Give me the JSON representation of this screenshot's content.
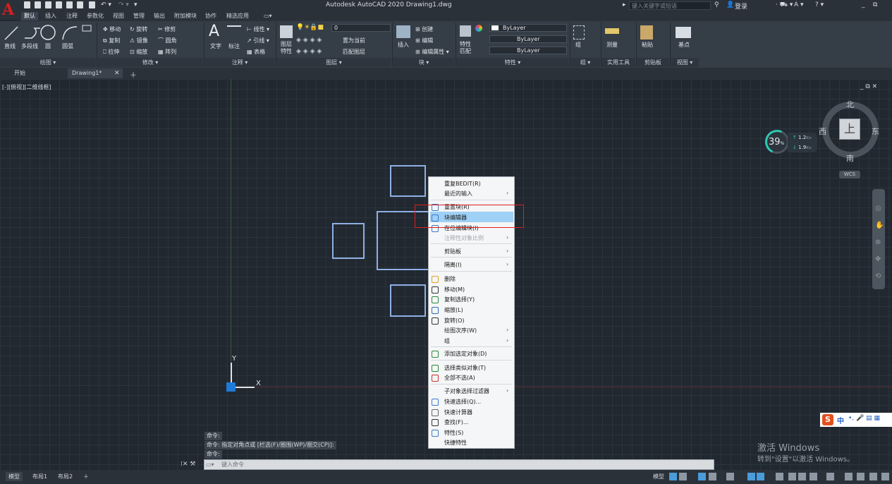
{
  "titlebar": {
    "title": "Autodesk AutoCAD 2020    Drawing1.dwg",
    "search_placeholder": "键入关键字或短语",
    "login": "登录",
    "app_letter": "A"
  },
  "ribbon_tabs": [
    "默认",
    "插入",
    "注释",
    "参数化",
    "视图",
    "管理",
    "输出",
    "附加模块",
    "协作",
    "精选应用"
  ],
  "ribbon": {
    "draw": {
      "footer": "绘图 ▾",
      "line": "直线",
      "polyline": "多段线",
      "circle": "圆",
      "arc": "圆弧"
    },
    "modify": {
      "footer": "修改 ▾",
      "items": [
        "移动",
        "旋转",
        "修剪",
        "复制",
        "镜像",
        "圆角",
        "拉伸",
        "缩放",
        "阵列"
      ]
    },
    "annotation": {
      "footer": "注释 ▾",
      "text": "文字",
      "dim": "标注",
      "linear": "线性",
      "leader": "引线",
      "table": "表格"
    },
    "layers": {
      "footer": "图层 ▾",
      "props": "图层\n特性",
      "layer_value": "0",
      "make_current": "置为当前",
      "match": "匹配图层"
    },
    "block": {
      "footer": "块 ▾",
      "insert": "插入",
      "create": "创建",
      "edit": "编辑",
      "edit_attr": "编辑属性"
    },
    "properties": {
      "footer": "特性 ▾",
      "match": "特性\n匹配",
      "color": "ByLayer",
      "linetype": "ByLayer",
      "lineweight": "ByLayer"
    },
    "groups": {
      "footer": "组 ▾",
      "label": "组"
    },
    "utilities": {
      "footer": "实用工具",
      "measure": "测量"
    },
    "clipboard": {
      "footer": "剪贴板",
      "paste": "粘贴"
    },
    "view": {
      "footer": "视图 ▾",
      "base": "基点"
    }
  },
  "doc_tabs": [
    "开始",
    "Drawing1*"
  ],
  "viewport_label": "[-][俯视][二维线框]",
  "context_menu": {
    "items": [
      {
        "label": "重复BEDIT(R)",
        "arrow": false,
        "disabled": false
      },
      {
        "label": "最近的输入",
        "arrow": true,
        "disabled": false
      },
      {
        "label": "重置块(R)",
        "arrow": false,
        "disabled": false
      },
      {
        "label": "块编辑器",
        "arrow": false,
        "disabled": false,
        "highlighted": true
      },
      {
        "label": "在位编辑块(I)",
        "arrow": false,
        "disabled": false
      },
      {
        "label": "注释性对象比例",
        "arrow": true,
        "disabled": true
      },
      {
        "label": "剪贴板",
        "arrow": true,
        "disabled": false
      },
      {
        "label": "隔离(I)",
        "arrow": true,
        "disabled": false
      },
      {
        "label": "删除",
        "arrow": false,
        "disabled": false
      },
      {
        "label": "移动(M)",
        "arrow": false,
        "disabled": false
      },
      {
        "label": "复制选择(Y)",
        "arrow": false,
        "disabled": false
      },
      {
        "label": "缩放(L)",
        "arrow": false,
        "disabled": false
      },
      {
        "label": "旋转(O)",
        "arrow": false,
        "disabled": false
      },
      {
        "label": "绘图次序(W)",
        "arrow": true,
        "disabled": false
      },
      {
        "label": "组",
        "arrow": true,
        "disabled": false
      },
      {
        "label": "添加选定对象(D)",
        "arrow": false,
        "disabled": false
      },
      {
        "label": "选择类似对象(T)",
        "arrow": false,
        "disabled": false
      },
      {
        "label": "全部不选(A)",
        "arrow": false,
        "disabled": false
      },
      {
        "label": "子对象选择过滤器",
        "arrow": true,
        "disabled": false
      },
      {
        "label": "快速选择(Q)...",
        "arrow": false,
        "disabled": false
      },
      {
        "label": "快速计算器",
        "arrow": false,
        "disabled": false
      },
      {
        "label": "查找(F)...",
        "arrow": false,
        "disabled": false
      },
      {
        "label": "特性(S)",
        "arrow": false,
        "disabled": false
      },
      {
        "label": "快捷特性",
        "arrow": false,
        "disabled": false
      }
    ]
  },
  "compass": {
    "north": "北",
    "south": "南",
    "east": "东",
    "west": "西",
    "center": "上",
    "wcs": "WCS"
  },
  "gauge": {
    "value": "39",
    "unit": "%",
    "up": "1.2",
    "down": "1.9",
    "rate_unit": "K/s"
  },
  "ucs": {
    "x": "X",
    "y": "Y"
  },
  "command": {
    "lines": [
      "命令:",
      "命令: 指定对角点或 [栏选(F)/圈围(WP)/圈交(CP)]:",
      "命令:"
    ],
    "placeholder": "键入命令"
  },
  "layout_tabs": [
    "模型",
    "布局1",
    "布局2"
  ],
  "status_model": "模型",
  "watermark": {
    "line1": "激活 Windows",
    "line2": "转到\"设置\"以激活 Windows。"
  },
  "ime": {
    "text": "中",
    "s_label": "S"
  }
}
